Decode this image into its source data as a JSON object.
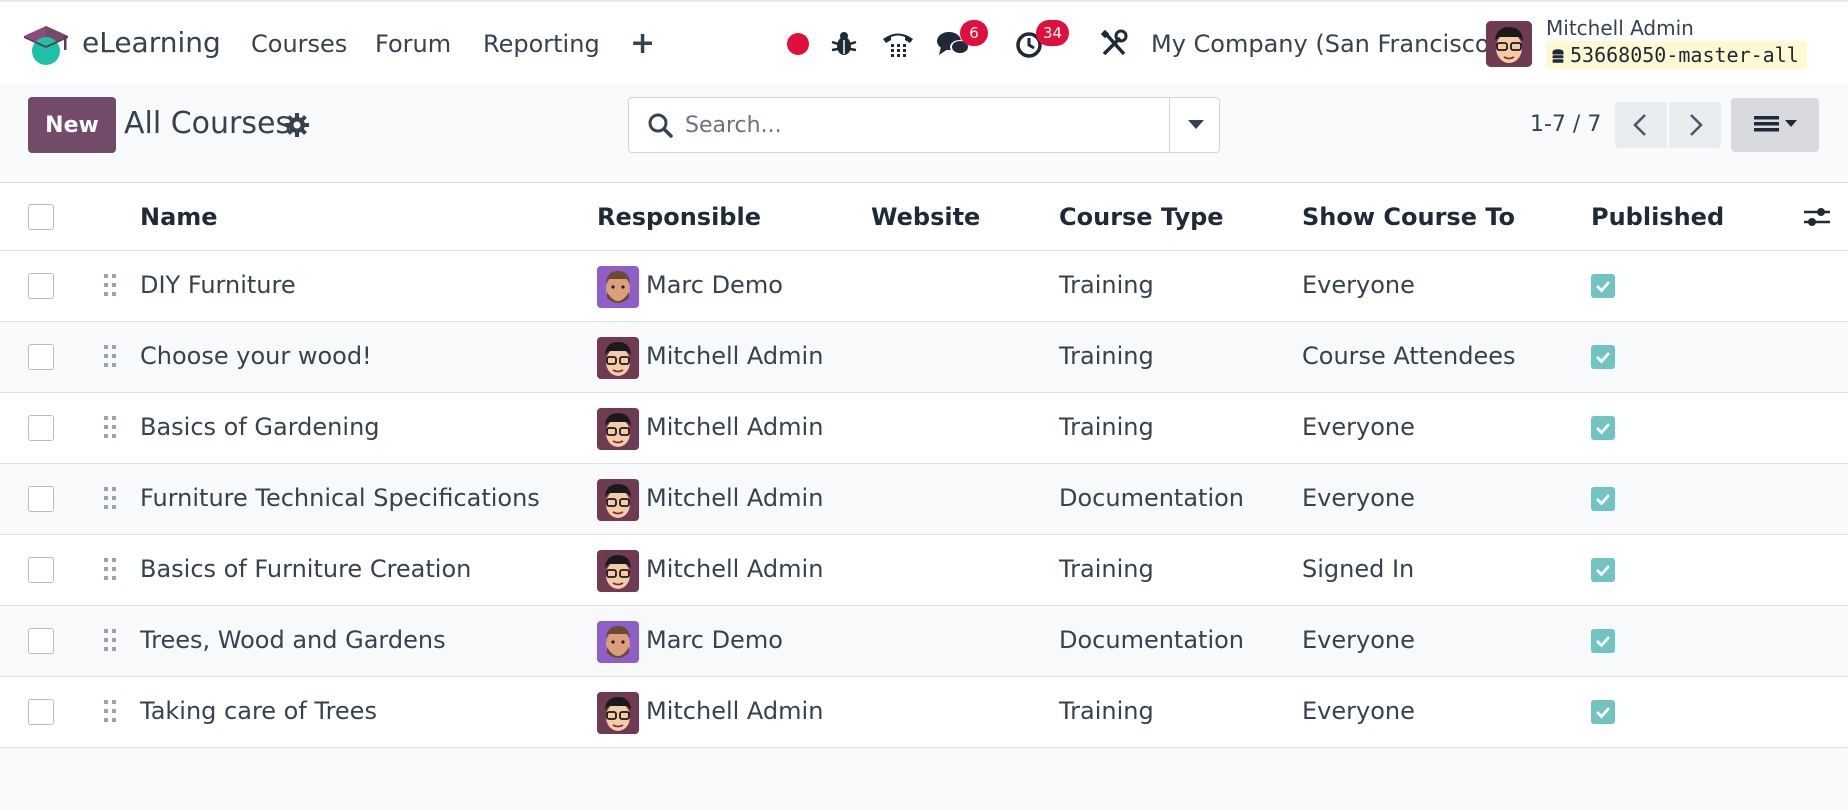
{
  "navbar": {
    "app_name": "eLearning",
    "menu": [
      "Courses",
      "Forum",
      "Reporting"
    ],
    "add_symbol": "+",
    "chat_badge": "6",
    "activity_badge": "34",
    "company": "My Company (San Francisco)",
    "user_name": "Mitchell Admin",
    "database": "53668050-master-all",
    "icons": [
      "record-dot-icon",
      "bug-icon",
      "phone-icon",
      "chat-icon",
      "clock-icon",
      "tools-icon",
      "database-icon"
    ]
  },
  "control_panel": {
    "new_label": "New",
    "breadcrumb": "All Courses",
    "search_placeholder": "Search...",
    "pager": "1-7 / 7"
  },
  "table": {
    "columns": [
      "Name",
      "Responsible",
      "Website",
      "Course Type",
      "Show Course To",
      "Published"
    ],
    "rows": [
      {
        "name": "DIY Furniture",
        "responsible": "Marc Demo",
        "website": "",
        "course_type": "Training",
        "show_to": "Everyone",
        "published": true
      },
      {
        "name": "Choose your wood!",
        "responsible": "Mitchell Admin",
        "website": "",
        "course_type": "Training",
        "show_to": "Course Attendees",
        "published": true
      },
      {
        "name": "Basics of Gardening",
        "responsible": "Mitchell Admin",
        "website": "",
        "course_type": "Training",
        "show_to": "Everyone",
        "published": true
      },
      {
        "name": "Furniture Technical Specifications",
        "responsible": "Mitchell Admin",
        "website": "",
        "course_type": "Documentation",
        "show_to": "Everyone",
        "published": true
      },
      {
        "name": "Basics of Furniture Creation",
        "responsible": "Mitchell Admin",
        "website": "",
        "course_type": "Training",
        "show_to": "Signed In",
        "published": true
      },
      {
        "name": "Trees, Wood and Gardens",
        "responsible": "Marc Demo",
        "website": "",
        "course_type": "Documentation",
        "show_to": "Everyone",
        "published": true
      },
      {
        "name": "Taking care of Trees",
        "responsible": "Mitchell Admin",
        "website": "",
        "course_type": "Training",
        "show_to": "Everyone",
        "published": true
      }
    ]
  },
  "colors": {
    "brand": "#714b67",
    "badge": "#e0103d",
    "record_dot": "#e0103d",
    "published_check": "#71c4c1"
  }
}
